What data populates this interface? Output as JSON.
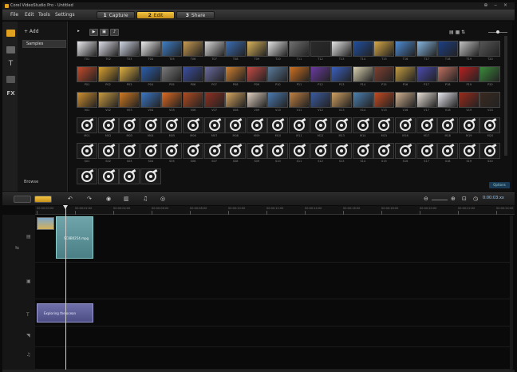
{
  "titlebar": {
    "title": "Corel VideoStudio Pro - Untitled",
    "window_controls": "⊕ ‒ ×"
  },
  "menu": {
    "items": [
      "File",
      "Edit",
      "Tools",
      "Settings"
    ],
    "steps": [
      {
        "num": "1",
        "label": "Capture",
        "active": false
      },
      {
        "num": "2",
        "label": "Edit",
        "active": true
      },
      {
        "num": "3",
        "label": "Share",
        "active": false
      }
    ]
  },
  "library": {
    "add_label": "+ Add",
    "folder": "Samples",
    "browse_label": "Browse",
    "options_label": "Options",
    "toolbar_icons": [
      "folder-icon",
      "video-filter-icon",
      "photo-filter-icon",
      "audio-filter-icon"
    ],
    "color_rows": [
      {
        "labels": [
          "T01",
          "T02",
          "T03",
          "T04",
          "T05",
          "T06",
          "T07",
          "T08",
          "T09",
          "T10",
          "T11",
          "T12",
          "T13",
          "T14",
          "T15",
          "T16",
          "T17",
          "T18",
          "T19",
          "T20"
        ],
        "colors": [
          "#e9e9ee",
          "#dcdce6",
          "#cfd5e2",
          "#ececec",
          "#3d7fc8",
          "#c79a50",
          "#d7d7d7",
          "#3b6eb5",
          "#d8b25a",
          "#e1e1e1",
          "#707070",
          "#2a2a2a",
          "#e5e5e5",
          "#1f4fa0",
          "#d9a845",
          "#4d8cd4",
          "#86b5e0",
          "#1b3f86",
          "#c0c0c0",
          "#555555"
        ]
      },
      {
        "labels": [
          "P01",
          "P02",
          "P03",
          "P04",
          "P05",
          "P06",
          "P07",
          "P08",
          "P09",
          "P10",
          "P11",
          "P12",
          "P13",
          "P14",
          "P15",
          "P16",
          "P17",
          "P18",
          "P19",
          "P20"
        ],
        "colors": [
          "#c54a2a",
          "#d6a030",
          "#e0b040",
          "#2a5fb0",
          "#7a7a7a",
          "#3a4ea0",
          "#6a6aa0",
          "#d08030",
          "#c44a44",
          "#5a7a9a",
          "#d07020",
          "#6a3aa0",
          "#3a60c0",
          "#d8d0b0",
          "#804030",
          "#c09a40",
          "#4a4ab0",
          "#c07060",
          "#b82020",
          "#3a8a3a"
        ]
      },
      {
        "labels": [
          "V01",
          "V02",
          "V03",
          "V04",
          "V05",
          "V06",
          "V07",
          "V08",
          "V09",
          "V10",
          "V11",
          "V12",
          "V13",
          "V14",
          "V15",
          "V16",
          "V17",
          "V18",
          "V19",
          "V20"
        ],
        "colors": [
          "#d09030",
          "#c89a40",
          "#d07a20",
          "#3a78c8",
          "#e06a20",
          "#b04a20",
          "#903020",
          "#d8a860",
          "#e0d0c0",
          "#4a7ab0",
          "#c08040",
          "#3a5aa0",
          "#d0a060",
          "#4a80b0",
          "#c84a20",
          "#d0b090",
          "#e8e0d8",
          "#e8e8f0",
          "#9a2a1a",
          "#3a2a20"
        ]
      }
    ],
    "disc_rows": [
      {
        "labels": [
          "M01",
          "M02",
          "M03",
          "M04",
          "M05",
          "M06",
          "M07",
          "M08",
          "M09",
          "M10",
          "M11",
          "M12",
          "M13",
          "M14",
          "M15",
          "M16",
          "M17",
          "M18",
          "M19",
          "M20"
        ]
      },
      {
        "labels": [
          "S01",
          "S02",
          "S03",
          "S04",
          "S05",
          "S06",
          "S07",
          "S08",
          "S09",
          "S10",
          "S11",
          "S12",
          "S13",
          "S14",
          "S15",
          "S16",
          "S17",
          "S18",
          "S19",
          "S20"
        ]
      },
      {
        "labels": [
          "A01",
          "A02",
          "A03",
          "A04"
        ]
      }
    ]
  },
  "timeline": {
    "timecode": "0:00:03:xx",
    "ruler": [
      "00:00:00:00",
      "00:00:02:00",
      "00:00:04:00",
      "00:00:06:00",
      "00:00:08:00",
      "00:00:10:00",
      "00:00:12:00",
      "00:00:14:00",
      "00:00:16:00",
      "00:00:18:00",
      "00:00:20:00",
      "00:00:22:00",
      "00:00:24:00"
    ],
    "video_clip_label": "SC8B0254.mpg",
    "title_clip_label": "Exploring the ocean",
    "track_icons": [
      "video-track-icon",
      "overlay-track-icon",
      "title-track-icon",
      "voice-track-icon",
      "music-track-icon"
    ]
  }
}
